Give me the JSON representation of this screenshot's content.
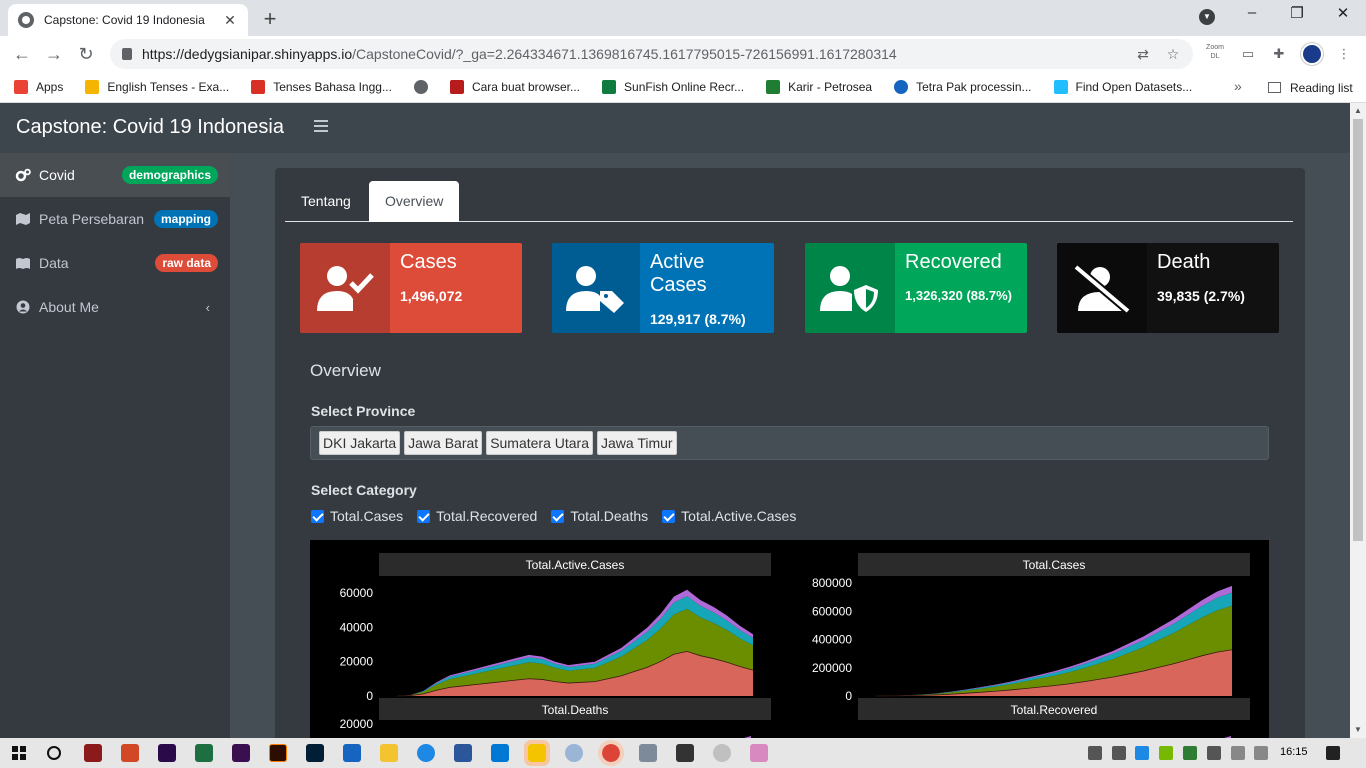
{
  "browser": {
    "tab_title": "Capstone: Covid 19 Indonesia",
    "url_host": "https://dedygsianipar.shinyapps.io",
    "url_rest": "/CapstoneCovid/?_ga=2.264334671.1369816745.1617795015-726156991.1617280314",
    "zoom_label": "Zoom DL",
    "bookmarks": [
      {
        "label": "Apps",
        "color": "#ea4335"
      },
      {
        "label": "English Tenses - Exa...",
        "color": "#f4b400"
      },
      {
        "label": "Tenses Bahasa Ingg...",
        "color": "#d93025"
      },
      {
        "label": "",
        "color": "#5f6368"
      },
      {
        "label": "Cara buat browser...",
        "color": "#b71c1c"
      },
      {
        "label": "SunFish Online Recr...",
        "color": "#0f7b3f"
      },
      {
        "label": "Karir - Petrosea",
        "color": "#1e7d32"
      },
      {
        "label": "Tetra Pak processin...",
        "color": "#1565c0"
      },
      {
        "label": "Find Open Datasets...",
        "color": "#20beff"
      }
    ],
    "bookmarks_more": "»",
    "reading_list": "Reading list"
  },
  "app": {
    "brand": "Capstone: Covid 19 Indonesia",
    "sidebar": [
      {
        "label": "Covid",
        "badge": "demographics",
        "badge_color": "#00a65a",
        "active": true,
        "icon": "cogs-icon"
      },
      {
        "label": "Peta Persebaran",
        "badge": "mapping",
        "badge_color": "#0073b7",
        "active": false,
        "icon": "map-icon"
      },
      {
        "label": "Data",
        "badge": "raw data",
        "badge_color": "#dd4b39",
        "active": false,
        "icon": "book-icon"
      },
      {
        "label": "About Me",
        "badge": "",
        "active": false,
        "icon": "user-circle-icon"
      }
    ],
    "tabs": [
      "Tentang",
      "Overview"
    ],
    "active_tab": "Overview",
    "value_boxes": [
      {
        "label": "Cases",
        "value": "1,496,072",
        "color": "#dd4b39",
        "icon_bg": "#b73d30",
        "icon": "user-check-icon"
      },
      {
        "label": "Active Cases",
        "value": "129,917 (8.7%)",
        "color": "#0073b7",
        "icon_bg": "#005d94",
        "icon": "user-tag-icon"
      },
      {
        "label": "Recovered",
        "value": "1,326,320 (88.7%)",
        "color": "#00a65a",
        "icon_bg": "#008549",
        "icon": "user-shield-icon"
      },
      {
        "label": "Death",
        "value": "39,835 (2.7%)",
        "color": "#111111",
        "icon_bg": "#0b0b0b",
        "icon": "user-slash-icon"
      }
    ],
    "overview_title": "Overview",
    "select_province_label": "Select Province",
    "provinces": [
      "DKI Jakarta",
      "Jawa Barat",
      "Sumatera Utara",
      "Jawa Timur"
    ],
    "select_category_label": "Select Category",
    "categories": [
      "Total.Cases",
      "Total.Recovered",
      "Total.Deaths",
      "Total.Active.Cases"
    ]
  },
  "chart_data": [
    {
      "type": "area",
      "title": "Total.Active.Cases",
      "ylim": [
        0,
        70000
      ],
      "ticks": [
        "60000",
        "40000",
        "20000",
        "0"
      ],
      "tick_values": [
        60000,
        40000,
        20000,
        0
      ],
      "stack_colors": [
        "#d9665b",
        "#6b8e00",
        "#17a5b8",
        "#b06ad8"
      ],
      "stack_totals": [
        0,
        500,
        3000,
        8000,
        12000,
        14000,
        16000,
        18000,
        20000,
        22000,
        24000,
        23000,
        20000,
        18000,
        19000,
        20000,
        24000,
        28000,
        34000,
        40000,
        48000,
        58000,
        62000,
        56000,
        52000,
        47000,
        41000,
        36000
      ]
    },
    {
      "type": "area",
      "title": "Total.Cases",
      "ylim": [
        0,
        850000
      ],
      "ticks": [
        "800000",
        "600000",
        "400000",
        "200000",
        "0"
      ],
      "tick_values": [
        800000,
        600000,
        400000,
        200000,
        0
      ],
      "stack_colors": [
        "#d9665b",
        "#6b8e00",
        "#17a5b8",
        "#b06ad8"
      ],
      "stack_totals": [
        0,
        2000,
        5000,
        10000,
        18000,
        30000,
        45000,
        62000,
        80000,
        100000,
        125000,
        150000,
        175000,
        205000,
        240000,
        280000,
        320000,
        370000,
        420000,
        480000,
        540000,
        610000,
        680000,
        740000,
        780000
      ]
    },
    {
      "type": "area",
      "title": "Total.Deaths",
      "ticks": [
        "20000"
      ],
      "tick_values": [
        20000
      ]
    },
    {
      "type": "area",
      "title": "Total.Recovered",
      "ticks": [],
      "tick_values": []
    }
  ],
  "taskbar": {
    "time": "16:15"
  }
}
